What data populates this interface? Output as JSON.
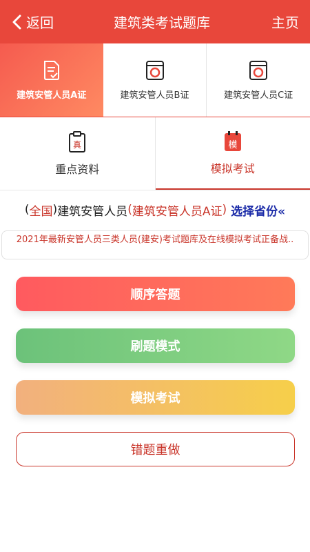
{
  "header": {
    "back_label": "返回",
    "title": "建筑类考试题库",
    "home_label": "主页"
  },
  "cert_tabs": [
    {
      "label": "建筑安管人员A证",
      "icon": "document-check-icon",
      "active": true
    },
    {
      "label": "建筑安管人员B证",
      "icon": "exam-badge-icon",
      "active": false
    },
    {
      "label": "建筑安管人员C证",
      "icon": "exam-badge-icon",
      "active": false
    }
  ],
  "resource_tabs": [
    {
      "label": "重点资料",
      "icon": "clipboard-icon",
      "icon_char": "真",
      "active": false
    },
    {
      "label": "模拟考试",
      "icon": "calendar-icon",
      "icon_char": "模",
      "active": true
    }
  ],
  "region": {
    "open_paren": "(",
    "region_name": "全国",
    "close_paren": ")",
    "category": "建筑安管人员",
    "cert_open": "(",
    "cert_name": "建筑安管人员A证",
    "cert_close": ")",
    "choose_label": "选择省份«"
  },
  "notice": "2021年最新安管人员三类人员(建安)考试题库及在线模拟考试正备战..",
  "actions": {
    "sequential": "顺序答题",
    "drill": "刷题模式",
    "mock_exam": "模拟考试",
    "redo_wrong": "错题重做"
  },
  "colors": {
    "brand_red": "#e8473b",
    "accent_red": "#c9352a",
    "link_blue": "#1b2ba8"
  }
}
